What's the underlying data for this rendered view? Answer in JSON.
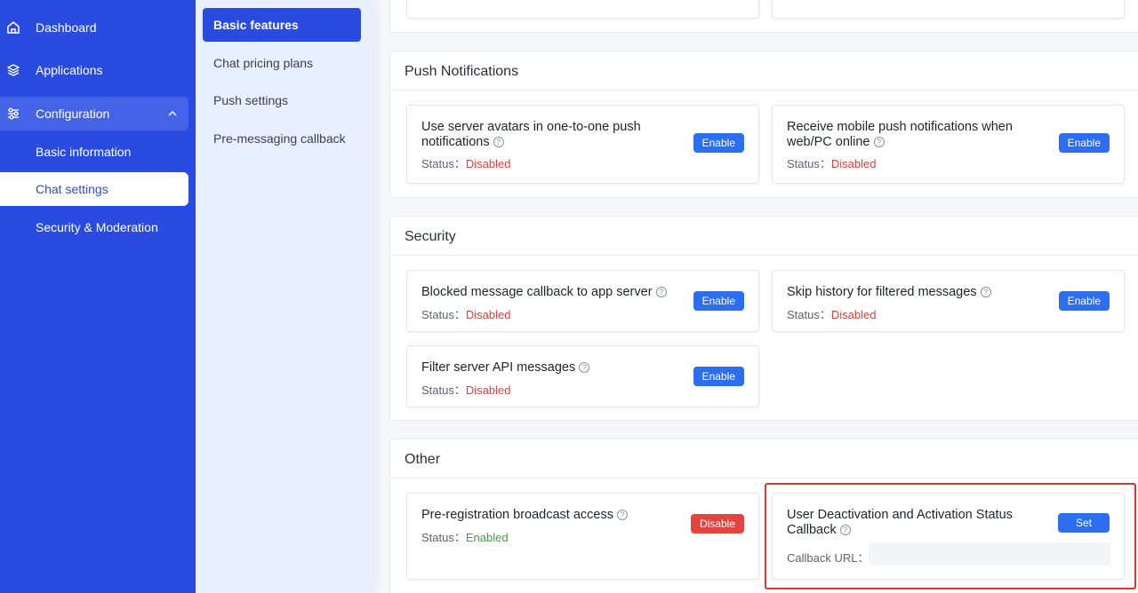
{
  "nav": {
    "items": [
      {
        "label": "Dashboard",
        "icon": "home-icon"
      },
      {
        "label": "Applications",
        "icon": "layers-icon"
      },
      {
        "label": "Configuration",
        "icon": "sliders-icon"
      },
      {
        "label": "Basic information"
      },
      {
        "label": "Chat settings"
      },
      {
        "label": "Security & Moderation"
      }
    ]
  },
  "subnav": {
    "items": [
      {
        "label": "Basic features"
      },
      {
        "label": "Chat pricing plans"
      },
      {
        "label": "Push settings"
      },
      {
        "label": "Pre-messaging callback"
      }
    ]
  },
  "common": {
    "status_label": "Status：",
    "disabled": "Disabled",
    "enabled": "Enabled",
    "enable": "Enable",
    "disable": "Disable",
    "set": "Set",
    "help_glyph": "?"
  },
  "push": {
    "title": "Push Notifications",
    "cards": [
      {
        "title": "Use server avatars in one-to-one push notifications"
      },
      {
        "title": "Receive mobile push notifications when web/PC online"
      }
    ]
  },
  "security": {
    "title": "Security",
    "cards": [
      {
        "title": "Blocked message callback to app server"
      },
      {
        "title": "Skip history for filtered messages"
      },
      {
        "title": "Filter server API messages"
      }
    ]
  },
  "other": {
    "title": "Other",
    "cards": [
      {
        "title": "Pre-registration broadcast access"
      },
      {
        "title": "User Deactivation and Activation Status Callback",
        "callback_label": "Callback URL：",
        "callback_value": ""
      }
    ]
  },
  "colors": {
    "nav_bg": "#2a4be0",
    "primary_button": "#2b6ef0",
    "danger_button": "#e2453f",
    "disabled_text": "#e0403a",
    "enabled_text": "#3aa43a",
    "highlight_border": "#e0352b"
  }
}
